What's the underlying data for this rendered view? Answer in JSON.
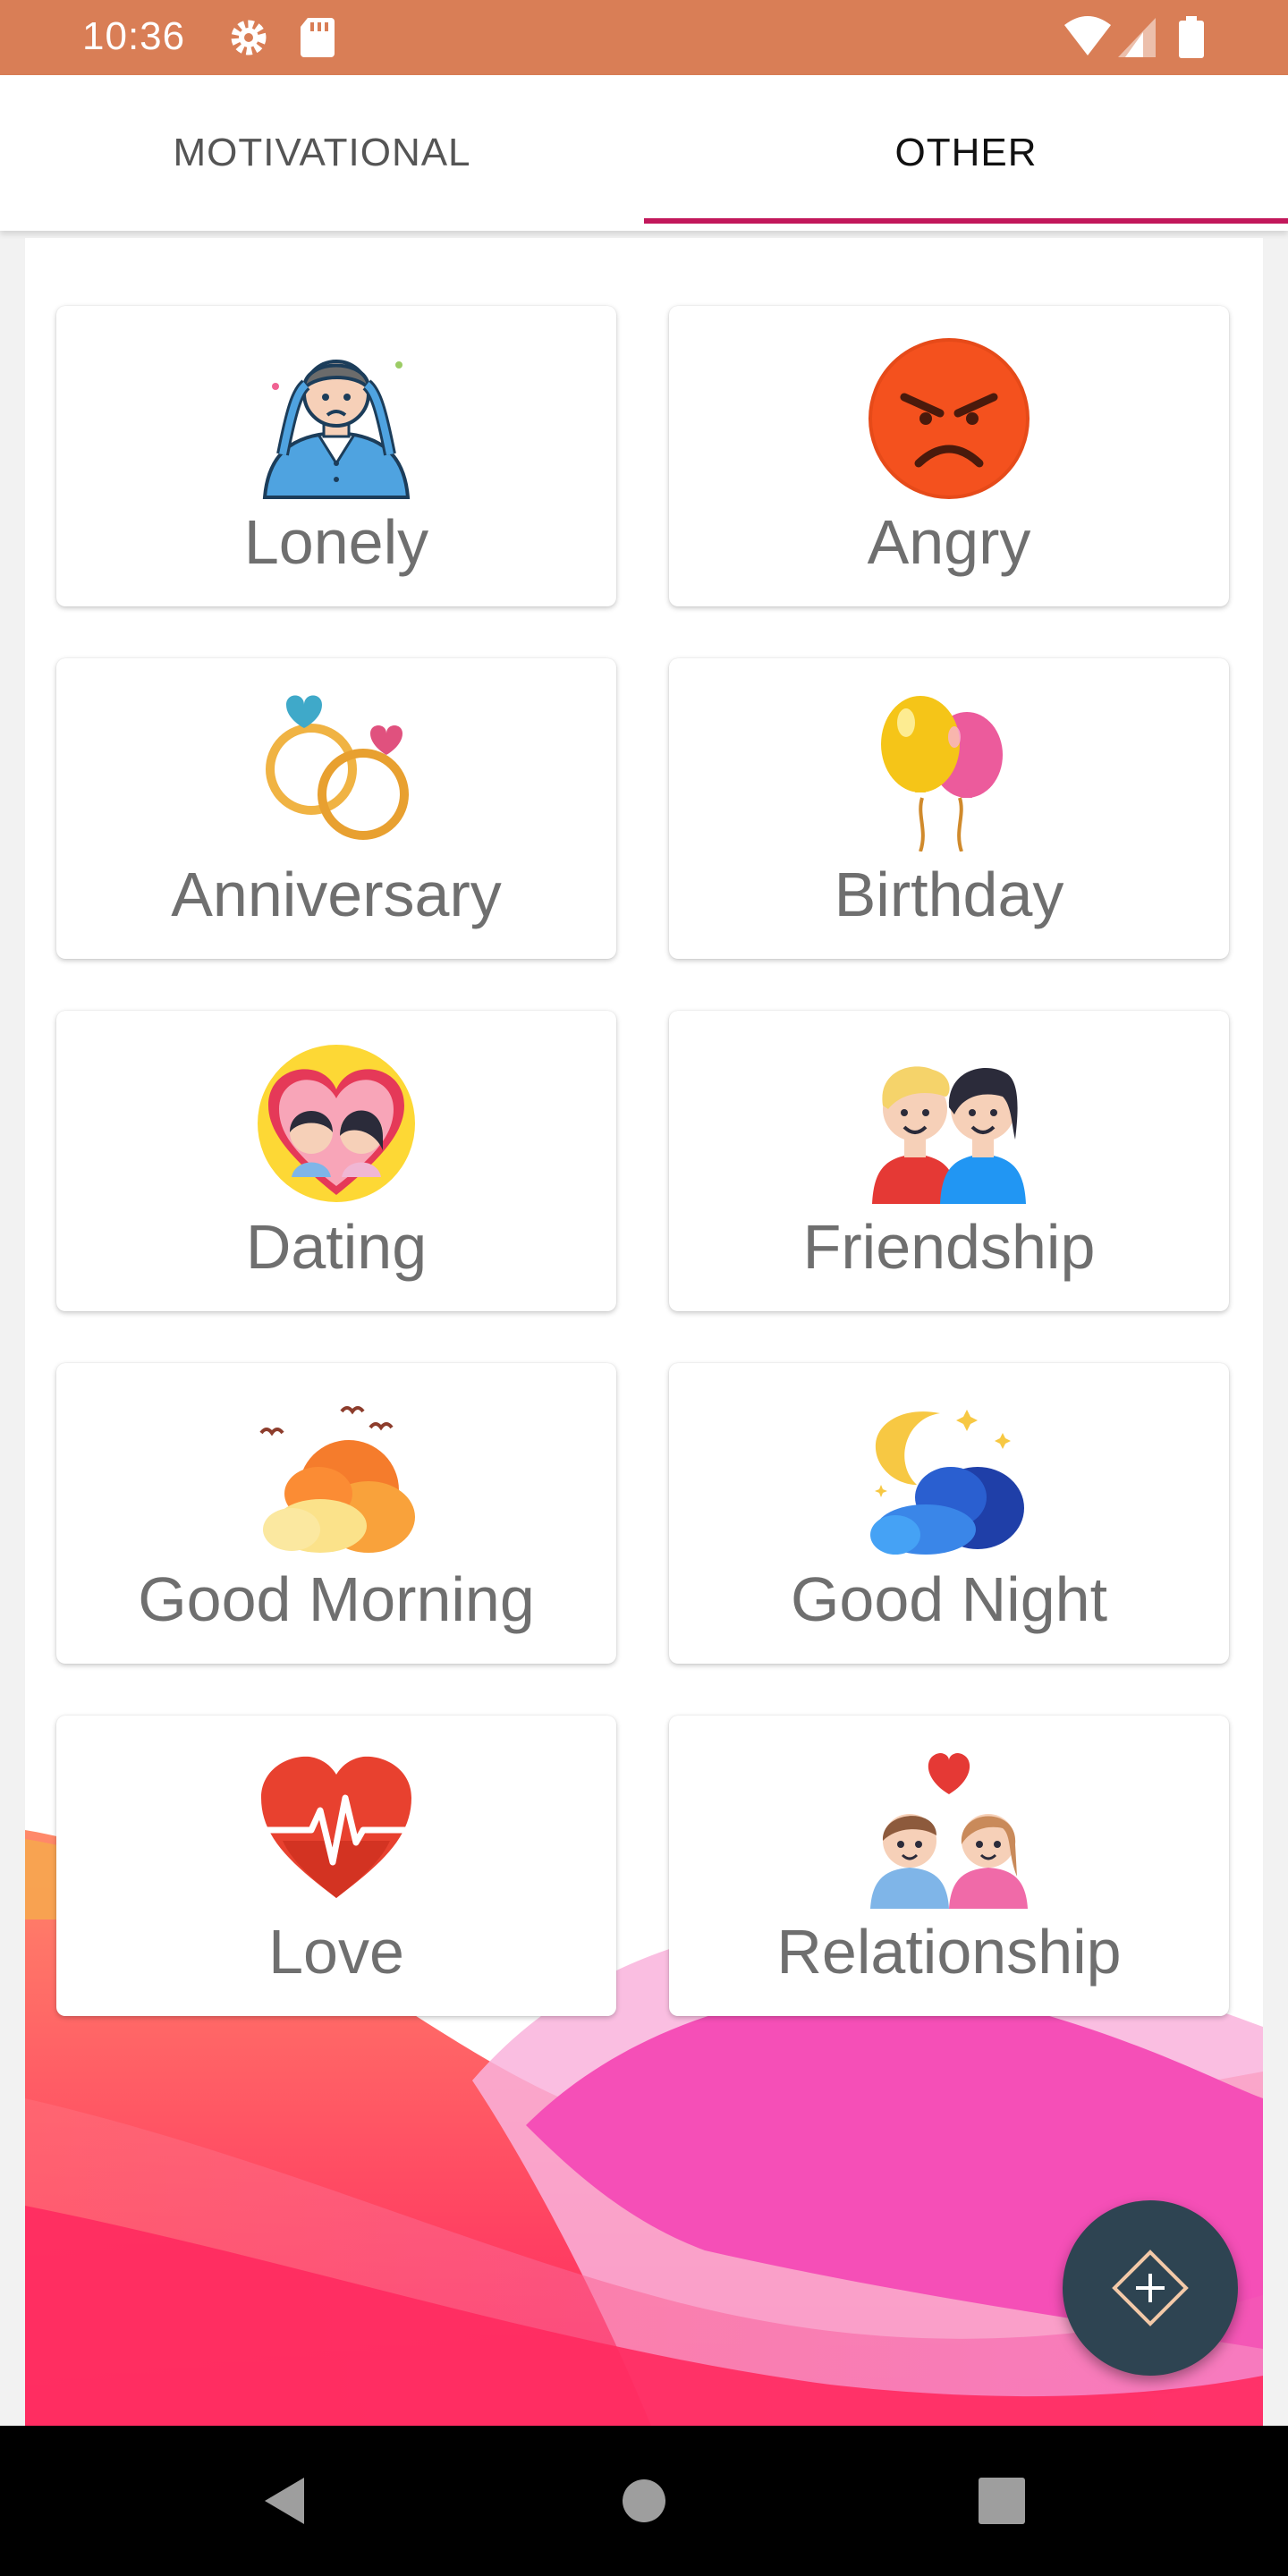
{
  "status_bar": {
    "time": "10:36",
    "icons": [
      "settings-icon",
      "sd-card-icon",
      "wifi-icon",
      "signal-icon",
      "battery-icon"
    ],
    "color": "#d97e56"
  },
  "tabs": [
    {
      "label": "MOTIVATIONAL",
      "active": false
    },
    {
      "label": "OTHER",
      "active": true
    }
  ],
  "accent_color": "#c2185b",
  "categories": [
    {
      "label": "Lonely",
      "icon": "lonely-person-icon"
    },
    {
      "label": "Angry",
      "icon": "angry-face-icon"
    },
    {
      "label": "Anniversary",
      "icon": "rings-icon"
    },
    {
      "label": "Birthday",
      "icon": "balloons-icon"
    },
    {
      "label": "Dating",
      "icon": "dating-couple-icon"
    },
    {
      "label": "Friendship",
      "icon": "friends-icon"
    },
    {
      "label": "Good Morning",
      "icon": "sunrise-cloud-icon"
    },
    {
      "label": "Good Night",
      "icon": "moon-cloud-icon"
    },
    {
      "label": "Love",
      "icon": "heartbeat-icon"
    },
    {
      "label": "Relationship",
      "icon": "couple-heart-icon"
    }
  ],
  "fab": {
    "icon": "diamond-plus-icon",
    "color": "#2e4452"
  },
  "nav_bar": {
    "buttons": [
      "back-icon",
      "home-icon",
      "recents-icon"
    ]
  }
}
